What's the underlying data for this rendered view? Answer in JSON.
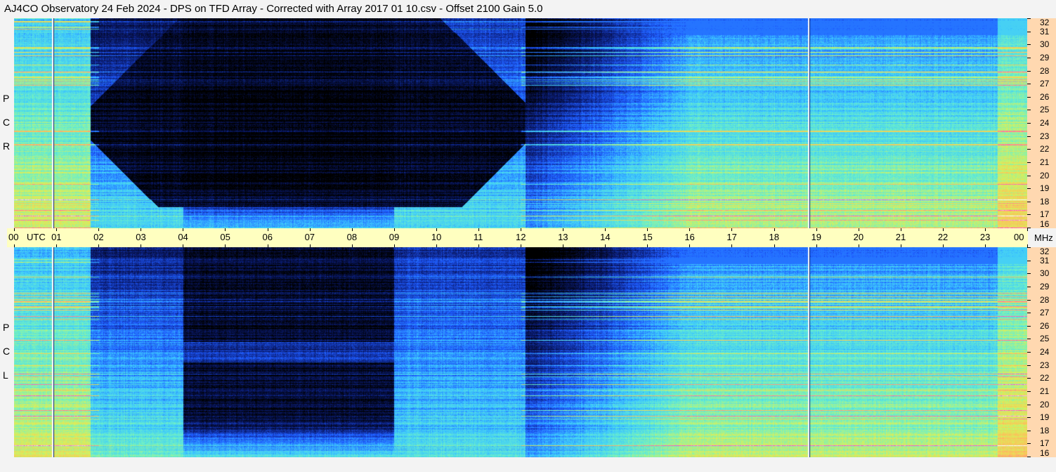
{
  "title": "AJ4CO Observatory  24 Feb 2024  -  DPS on TFD Array  -  Corrected with Array 2017 01 10.csv  -  Offset 2100  Gain 5.0",
  "panels": {
    "top": {
      "side_letters": [
        "P",
        "C",
        "R"
      ]
    },
    "bottom": {
      "side_letters": [
        "P",
        "C",
        "L"
      ]
    }
  },
  "utc_axis": {
    "labels": [
      "00",
      "01",
      "02",
      "03",
      "04",
      "05",
      "06",
      "07",
      "08",
      "09",
      "10",
      "11",
      "12",
      "13",
      "14",
      "15",
      "16",
      "17",
      "18",
      "19",
      "20",
      "21",
      "22",
      "23",
      "00"
    ],
    "unit_label": "UTC",
    "freq_unit_label": "MHz"
  },
  "chart_data": [
    {
      "type": "heatmap",
      "title": "RCP",
      "x": {
        "label": "UTC",
        "range_hours": [
          0,
          24
        ]
      },
      "y": {
        "label": "MHz",
        "range": [
          16,
          32
        ],
        "ticks": [
          16,
          17,
          18,
          19,
          20,
          21,
          22,
          23,
          24,
          25,
          26,
          27,
          28,
          29,
          30,
          31,
          32
        ]
      },
      "colormap": [
        "#000000",
        "#0a1a6e",
        "#1e5aff",
        "#3cc8ff",
        "#6cf0c8",
        "#d8f05a",
        "#ffbe5a",
        "#ff50c8",
        "#ffffff"
      ],
      "features": [
        {
          "kind": "quiet_night",
          "from_utc": 4.0,
          "to_utc": 9.0
        },
        {
          "kind": "band_edge",
          "utc": 12.1
        },
        {
          "kind": "vertical_marker",
          "utc": 0.9
        },
        {
          "kind": "vertical_marker",
          "utc": 18.8
        }
      ]
    },
    {
      "type": "heatmap",
      "title": "LCP",
      "x": {
        "label": "UTC",
        "range_hours": [
          0,
          24
        ]
      },
      "y": {
        "label": "MHz",
        "range": [
          16,
          32
        ],
        "ticks": [
          16,
          17,
          18,
          19,
          20,
          21,
          22,
          23,
          24,
          25,
          26,
          27,
          28,
          29,
          30,
          31,
          32
        ]
      },
      "colormap": [
        "#000000",
        "#0a1a6e",
        "#1e5aff",
        "#3cc8ff",
        "#6cf0c8",
        "#d8f05a",
        "#ffbe5a",
        "#ff50c8",
        "#ffffff"
      ],
      "features": [
        {
          "kind": "quiet_night",
          "from_utc": 4.0,
          "to_utc": 9.0
        },
        {
          "kind": "band_edge",
          "utc": 12.1
        },
        {
          "kind": "vertical_marker",
          "utc": 0.9
        },
        {
          "kind": "vertical_marker",
          "utc": 18.8
        }
      ]
    }
  ]
}
